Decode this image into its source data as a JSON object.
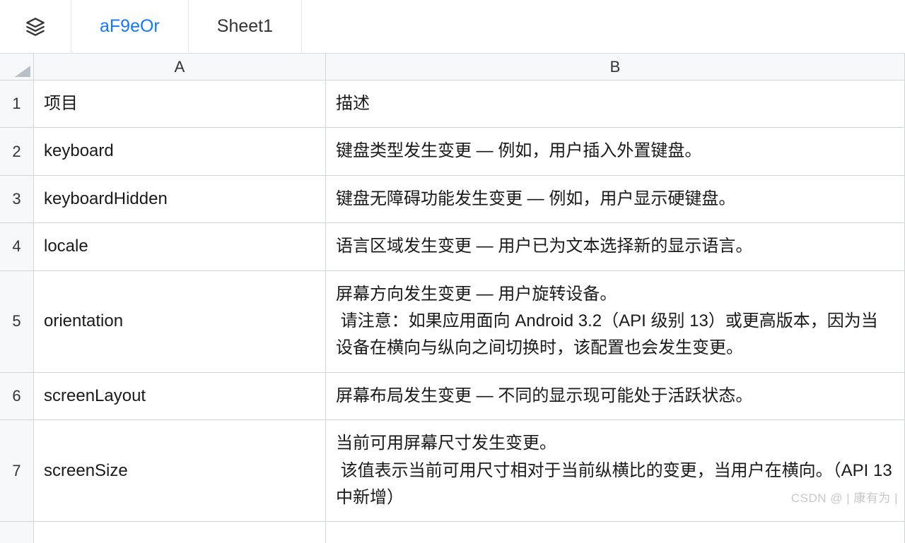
{
  "tabs": {
    "active": "aF9eOr",
    "inactive": "Sheet1"
  },
  "columns": {
    "a": "A",
    "b": "B"
  },
  "rows": [
    {
      "num": "1",
      "a": "项目",
      "b": "描述"
    },
    {
      "num": "2",
      "a": "keyboard",
      "b": "键盘类型发生变更 — 例如，用户插入外置键盘。"
    },
    {
      "num": "3",
      "a": "keyboardHidden",
      "b": "键盘无障碍功能发生变更 — 例如，用户显示硬键盘。"
    },
    {
      "num": "4",
      "a": "locale",
      "b": "语言区域发生变更 — 用户已为文本选择新的显示语言。"
    },
    {
      "num": "5",
      "a": "orientation",
      "b": "屏幕方向发生变更 — 用户旋转设备。\n 请注意：如果应用面向 Android 3.2（API 级别 13）或更高版本，因为当设备在横向与纵向之间切换时，该配置也会发生变更。"
    },
    {
      "num": "6",
      "a": "screenLayout",
      "b": "屏幕布局发生变更 — 不同的显示现可能处于活跃状态。"
    },
    {
      "num": "7",
      "a": "screenSize",
      "b": "当前可用屏幕尺寸发生变更。\n 该值表示当前可用尺寸相对于当前纵横比的变更，当用户在横向。（API 13 中新增）"
    }
  ],
  "watermark": "CSDN @ | 康有为 |"
}
